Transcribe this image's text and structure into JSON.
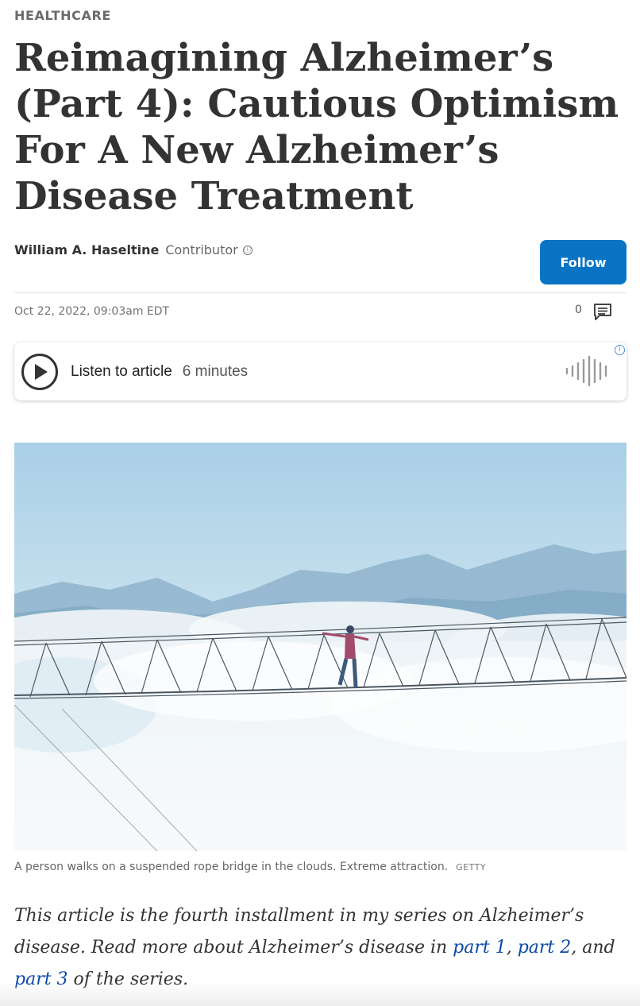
{
  "category": "HEALTHCARE",
  "headline": "Reimagining Alzheimer’s (Part 4): Cautious Optimism For A New Alzheimer’s Disease Treatment",
  "byline": {
    "author": "William A. Haseltine",
    "role": "Contributor",
    "info_icon": "ⓘ"
  },
  "follow_label": "Follow",
  "date": "Oct 22, 2022, 09:03am EDT",
  "comments": {
    "count": "0",
    "icon": "comment-icon"
  },
  "audio": {
    "label": "Listen to article",
    "duration": "6 minutes",
    "info_icon": "i"
  },
  "image": {
    "caption": "A person walks on a suspended rope bridge in the clouds. Extreme attraction.",
    "credit": "GETTY"
  },
  "intro": {
    "text_1": "This article is the fourth installment in my series on Alzheimer’s disease. Read more about Alzheimer’s disease in ",
    "link_1": "part 1",
    "sep_1": ", ",
    "link_2": "part 2",
    "sep_2": ", and ",
    "link_3": "part 3",
    "text_2": " of the series."
  },
  "colors": {
    "follow_button": "#0a74c4",
    "link": "#0b4aa6",
    "sky": "#bfdcec"
  }
}
